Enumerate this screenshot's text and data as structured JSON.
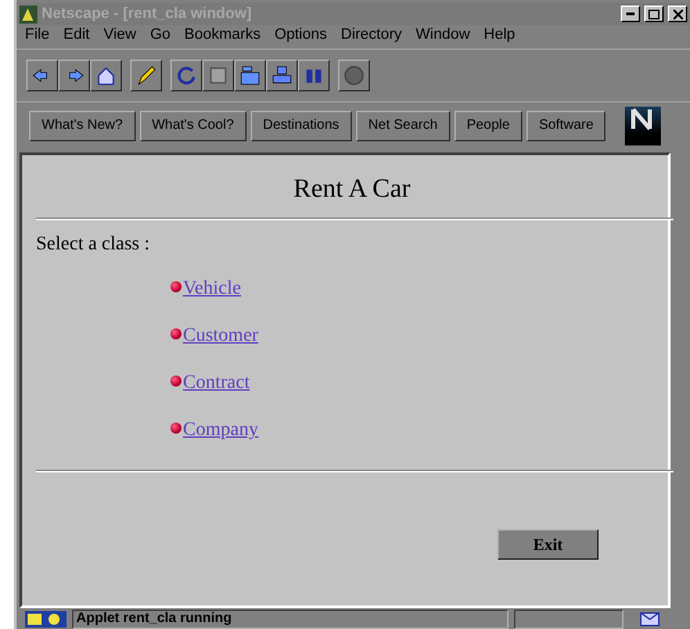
{
  "window": {
    "title": "Netscape - [rent_cla window]"
  },
  "menu": [
    "File",
    "Edit",
    "View",
    "Go",
    "Bookmarks",
    "Options",
    "Directory",
    "Window",
    "Help"
  ],
  "directory_buttons": [
    "What's New?",
    "What's Cool?",
    "Destinations",
    "Net Search",
    "People",
    "Software"
  ],
  "page": {
    "heading": "Rent A Car",
    "prompt": "Select a class :",
    "links": [
      "Vehicle",
      "Customer",
      "Contract",
      "Company"
    ],
    "exit_button": "Exit"
  },
  "status_bar": {
    "message": "Applet rent_cla running"
  }
}
